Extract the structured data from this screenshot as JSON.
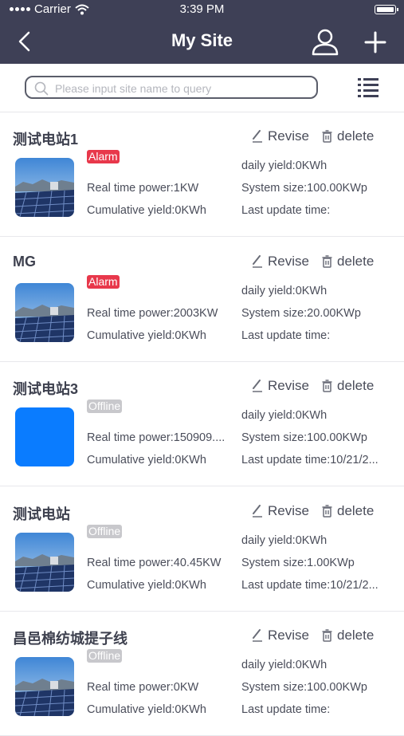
{
  "status_bar": {
    "carrier": "Carrier",
    "time": "3:39 PM"
  },
  "nav": {
    "title": "My Site"
  },
  "search": {
    "placeholder": "Please input site name to query"
  },
  "actions": {
    "revise": "Revise",
    "delete": "delete"
  },
  "labels": {
    "daily_yield": "daily yield:",
    "real_time_power": "Real time power:",
    "system_size": "System size:",
    "cumulative_yield": "Cumulative yield:",
    "last_update": "Last update time:"
  },
  "sites": [
    {
      "name": "测试电站1",
      "status": "Alarm",
      "daily_yield": "daily yield:0KWh",
      "real_time_power": "Real time power:1KW",
      "system_size": "System size:100.00KWp",
      "cumulative_yield": "Cumulative yield:0KWh",
      "last_update": "Last update time:",
      "thumb": "solar-photo"
    },
    {
      "name": "MG",
      "status": "Alarm",
      "daily_yield": "daily yield:0KWh",
      "real_time_power": "Real time power:2003KW",
      "system_size": "System size:20.00KWp",
      "cumulative_yield": "Cumulative yield:0KWh",
      "last_update": "Last update time:",
      "thumb": "solar-photo"
    },
    {
      "name": "测试电站3",
      "status": "Offline",
      "daily_yield": "daily yield:0KWh",
      "real_time_power": "Real time power:150909....",
      "system_size": "System size:100.00KWp",
      "cumulative_yield": "Cumulative yield:0KWh",
      "last_update": "Last update time:10/21/2...",
      "thumb": "blue-placeholder"
    },
    {
      "name": "测试电站",
      "status": "Offline",
      "daily_yield": "daily yield:0KWh",
      "real_time_power": "Real time power:40.45KW",
      "system_size": "System size:1.00KWp",
      "cumulative_yield": "Cumulative yield:0KWh",
      "last_update": "Last update time:10/21/2...",
      "thumb": "solar-photo"
    },
    {
      "name": "昌邑棉纺城提子线",
      "status": "Offline",
      "daily_yield": "daily yield:0KWh",
      "real_time_power": "Real time power:0KW",
      "system_size": "System size:100.00KWp",
      "cumulative_yield": "Cumulative yield:0KWh",
      "last_update": "Last update time:",
      "thumb": "solar-photo"
    }
  ],
  "colors": {
    "header": "#3e4056",
    "alarm": "#e8384b",
    "offline": "#c8c8cc",
    "placeholder_blue": "#0a7cff"
  }
}
